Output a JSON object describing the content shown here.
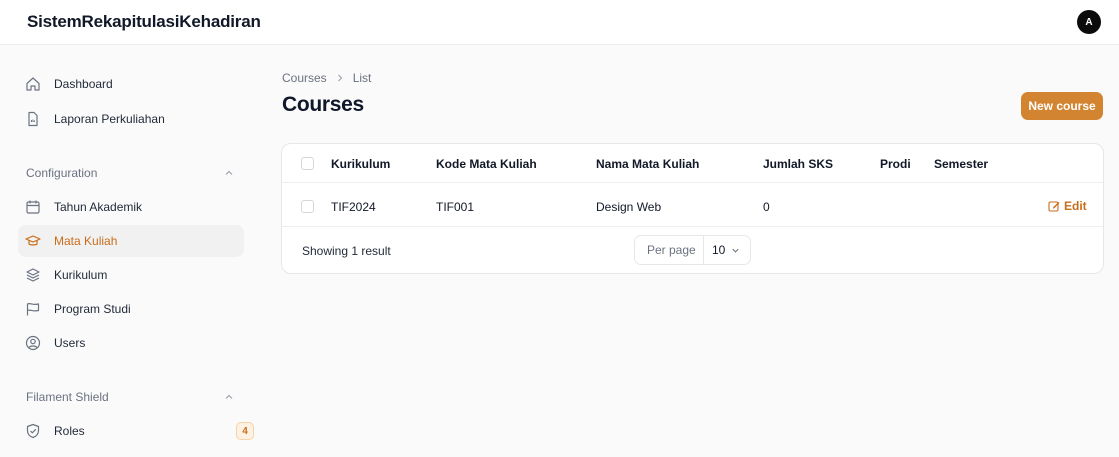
{
  "app": {
    "brand": "SistemRekapitulasiKehadiran",
    "avatar_initial": "A"
  },
  "sidebar": {
    "items": [
      {
        "label": "Dashboard",
        "icon": "home-icon"
      },
      {
        "label": "Laporan Perkuliahan",
        "icon": "document-icon"
      }
    ],
    "groups": [
      {
        "label": "Configuration",
        "items": [
          {
            "label": "Tahun Akademik",
            "icon": "calendar-icon"
          },
          {
            "label": "Mata Kuliah",
            "icon": "academic-cap-icon",
            "active": true
          },
          {
            "label": "Kurikulum",
            "icon": "stack-icon"
          },
          {
            "label": "Program Studi",
            "icon": "flag-icon"
          },
          {
            "label": "Users",
            "icon": "user-circle-icon"
          }
        ]
      },
      {
        "label": "Filament Shield",
        "items": [
          {
            "label": "Roles",
            "icon": "shield-check-icon",
            "badge": "4"
          }
        ]
      }
    ]
  },
  "breadcrumb": {
    "parent": "Courses",
    "current": "List"
  },
  "page": {
    "title": "Courses",
    "new_button": "New course"
  },
  "table": {
    "columns": [
      "Kurikulum",
      "Kode Mata Kuliah",
      "Nama Mata Kuliah",
      "Jumlah SKS",
      "Prodi",
      "Semester"
    ],
    "rows": [
      {
        "kurikulum": "TIF2024",
        "kode": "TIF001",
        "nama": "Design Web",
        "sks": "0",
        "prodi": "",
        "semester": "",
        "action": "Edit"
      }
    ],
    "footer": {
      "showing": "Showing 1 result",
      "per_page_label": "Per page",
      "per_page_value": "10"
    }
  },
  "colors": {
    "accent": "#d28431",
    "active_text": "#c96d1b"
  }
}
